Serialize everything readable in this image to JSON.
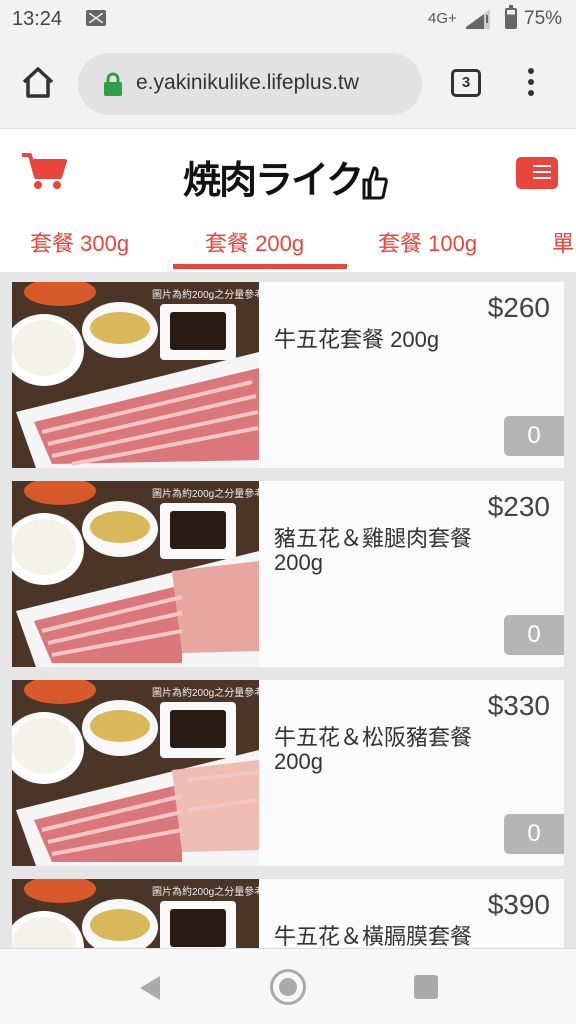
{
  "status_bar": {
    "time": "13:24",
    "network": "4G+",
    "battery": "75%",
    "icons": [
      "gmail-icon",
      "signal-icon",
      "battery-icon"
    ]
  },
  "browser": {
    "url": "e.yakinikulike.lifeplus.tw",
    "tab_count": "3"
  },
  "header": {
    "logo_text": "焼肉ライク",
    "colors": {
      "accent": "#e8453c"
    }
  },
  "tabs": [
    {
      "label": "套餐 300g",
      "active": false
    },
    {
      "label": "套餐 200g",
      "active": true
    },
    {
      "label": "套餐 100g",
      "active": false
    },
    {
      "label": "單",
      "active": false
    }
  ],
  "products": [
    {
      "name": "牛五花套餐 200g",
      "price": "$260",
      "qty": "0",
      "image_note": "圖片為約200g之分量參考",
      "variant": "beef"
    },
    {
      "name": "豬五花＆雞腿肉套餐 200g",
      "price": "$230",
      "qty": "0",
      "image_note": "圖片為約200g之分量參考",
      "variant": "pork-chicken"
    },
    {
      "name": "牛五花＆松阪豬套餐 200g",
      "price": "$330",
      "qty": "0",
      "image_note": "圖片為約200g之分量參考",
      "variant": "beef-pork"
    },
    {
      "name": "牛五花＆橫膈膜套餐",
      "price": "$390",
      "qty": "0",
      "image_note": "圖片為約200g之分量參考",
      "variant": "beef-skirt"
    }
  ]
}
